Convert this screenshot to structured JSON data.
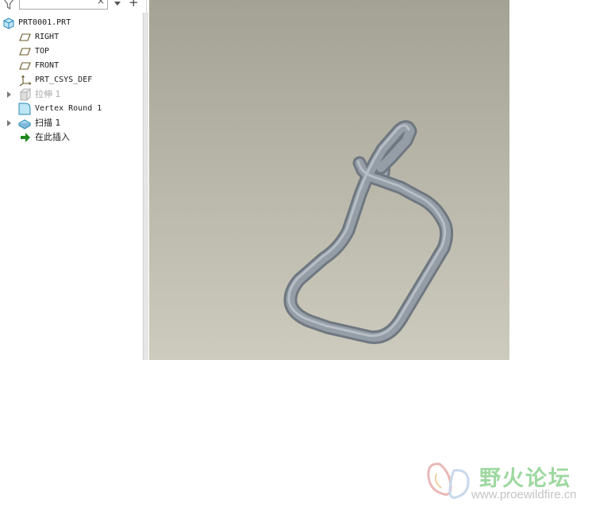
{
  "toolbar": {
    "filter_icon": "filter-funnel-icon",
    "search_value": "",
    "clear_symbol": "×",
    "dropdown_icon": "chevron-down-icon",
    "add_symbol": "+"
  },
  "model_tree": {
    "items": [
      {
        "label": "PRT0001.PRT",
        "icon": "part-icon",
        "expandable": false
      },
      {
        "label": "RIGHT",
        "icon": "datum-plane-icon",
        "expandable": false
      },
      {
        "label": "TOP",
        "icon": "datum-plane-icon",
        "expandable": false
      },
      {
        "label": "FRONT",
        "icon": "datum-plane-icon",
        "expandable": false
      },
      {
        "label": "PRT_CSYS_DEF",
        "icon": "coordinate-system-icon",
        "expandable": false
      },
      {
        "label": "拉伸 1",
        "icon": "extrude-icon",
        "expandable": true,
        "suppressed": true
      },
      {
        "label": "Vertex Round 1",
        "icon": "vertex-round-icon",
        "expandable": false
      },
      {
        "label": "扫描 1",
        "icon": "sweep-icon",
        "expandable": true
      },
      {
        "label": "在此插入",
        "icon": "insert-here-arrow-icon",
        "expandable": false
      }
    ]
  },
  "viewport": {
    "content": "3D bent wire model",
    "colors": {
      "background_top": "#a4a294",
      "background_bottom": "#cdcbbd",
      "model": "#8f97a0"
    }
  },
  "watermark": {
    "title": "野火论坛",
    "url": "www.proewildfire.cn",
    "colors": {
      "title": "#9ed8a0",
      "url": "#c4c4c4"
    }
  }
}
